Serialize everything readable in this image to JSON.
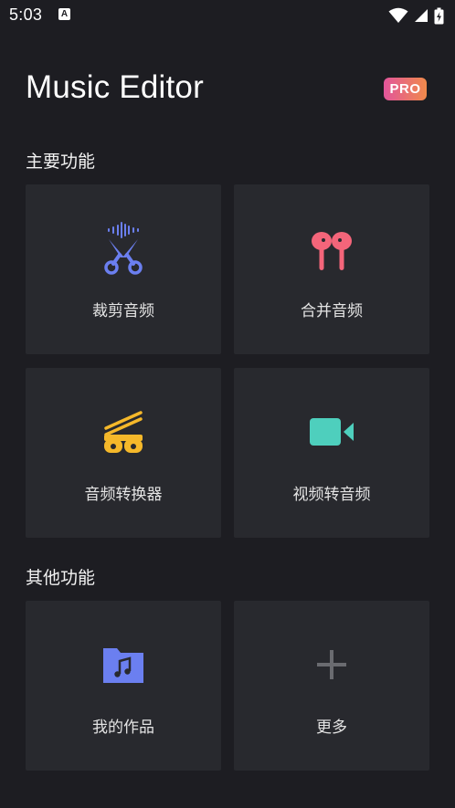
{
  "status_bar": {
    "time": "5:03",
    "a11y_glyph": "A"
  },
  "header": {
    "title": "Music Editor",
    "pro_badge": "PRO"
  },
  "sections": {
    "main_title": "主要功能",
    "other_title": "其他功能"
  },
  "tiles": {
    "trim_audio": "裁剪音频",
    "merge_audio": "合并音频",
    "audio_converter": "音频转换器",
    "video_to_audio": "视频转音频",
    "my_works": "我的作品",
    "more": "更多"
  },
  "colors": {
    "background": "#1d1d22",
    "tile": "#28292e",
    "scissors": "#6b7ff0",
    "earbuds": "#f4657a",
    "converter": "#f5b82a",
    "video": "#4ecfbd",
    "folder": "#6b7ff0",
    "plus": "#6a6b70",
    "pro_gradient_start": "#e2559b",
    "pro_gradient_end": "#f08a4b"
  },
  "icons": {
    "trim": "scissors-waveform-icon",
    "merge": "earbuds-icon",
    "convert": "reels-icon",
    "video": "video-camera-icon",
    "works": "music-folder-icon",
    "more": "plus-icon"
  }
}
